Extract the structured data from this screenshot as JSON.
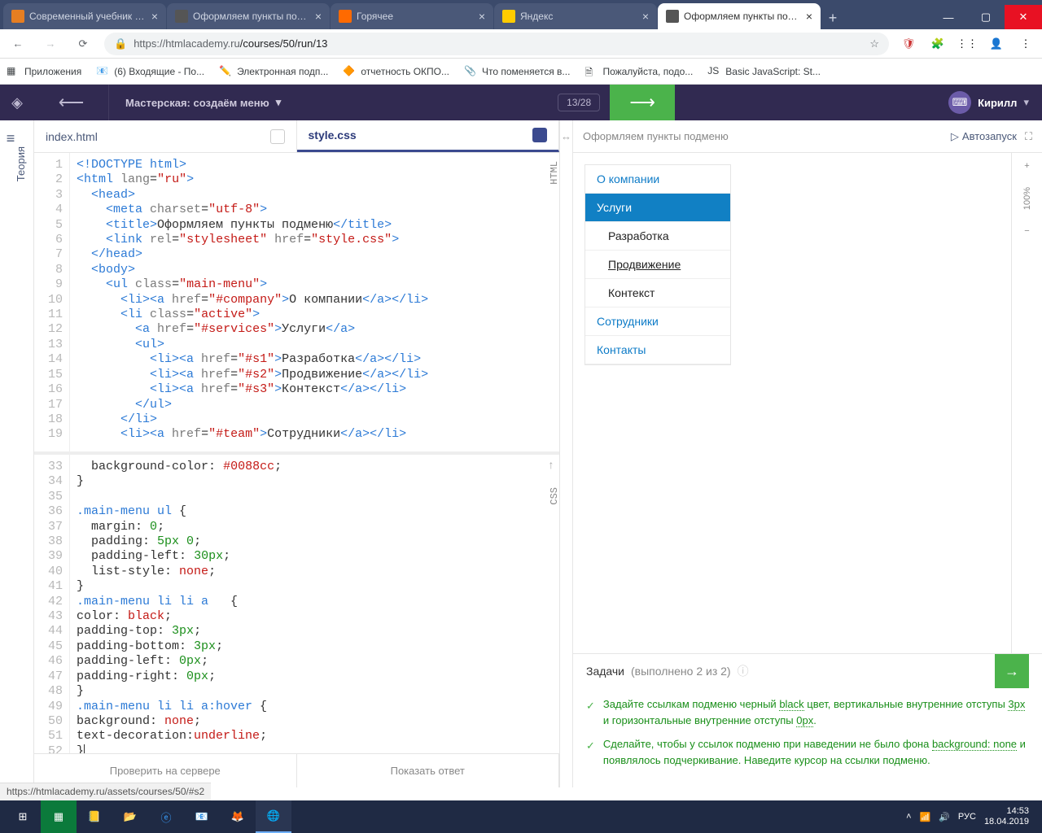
{
  "browser": {
    "tabs": [
      {
        "title": "Современный учебник Java",
        "favcolor": "#e67e22"
      },
      {
        "title": "Оформляем пункты подме",
        "favcolor": "#555"
      },
      {
        "title": "Горячее",
        "favcolor": "#ff6a00"
      },
      {
        "title": "Яндекс",
        "favcolor": "#ffcc00"
      },
      {
        "title": "Оформляем пункты подме",
        "favcolor": "#555",
        "active": true
      }
    ],
    "url_host": "https://htmlacademy.ru",
    "url_path": "/courses/50/run/13",
    "bookmarks": [
      {
        "label": "Приложения"
      },
      {
        "label": "(6) Входящие - По..."
      },
      {
        "label": "Электронная подп..."
      },
      {
        "label": "отчетность ОКПО..."
      },
      {
        "label": "Что поменяется в..."
      },
      {
        "label": "Пожалуйста, подо..."
      },
      {
        "label": "Basic JavaScript: St..."
      }
    ]
  },
  "app": {
    "title": "Мастерская: создаём меню",
    "progress": "13/28",
    "username": "Кирилл",
    "theory_label": "Теория"
  },
  "editor": {
    "tabs": [
      {
        "name": "index.html"
      },
      {
        "name": "style.css",
        "active": true
      }
    ],
    "html_vlabel": "HTML",
    "css_vlabel": "CSS",
    "footer": [
      "Проверить на сервере",
      "Показать ответ"
    ],
    "top_lines": [
      {
        "n": 1,
        "html": "<span class='t-tag'>&lt;!DOCTYPE html&gt;</span>"
      },
      {
        "n": 2,
        "html": "<span class='t-tag'>&lt;html</span> <span class='t-attr'>lang</span>=<span class='t-str'>\"ru\"</span><span class='t-tag'>&gt;</span>"
      },
      {
        "n": 3,
        "html": "  <span class='t-tag'>&lt;head&gt;</span>"
      },
      {
        "n": 4,
        "html": "    <span class='t-tag'>&lt;meta</span> <span class='t-attr'>charset</span>=<span class='t-str'>\"utf-8\"</span><span class='t-tag'>&gt;</span>"
      },
      {
        "n": 5,
        "html": "    <span class='t-tag'>&lt;title&gt;</span>Оформляем пункты подменю<span class='t-tag'>&lt;/title&gt;</span>"
      },
      {
        "n": 6,
        "html": "    <span class='t-tag'>&lt;link</span> <span class='t-attr'>rel</span>=<span class='t-str'>\"stylesheet\"</span> <span class='t-attr'>href</span>=<span class='t-str'>\"style.css\"</span><span class='t-tag'>&gt;</span>"
      },
      {
        "n": 7,
        "html": "  <span class='t-tag'>&lt;/head&gt;</span>"
      },
      {
        "n": 8,
        "html": "  <span class='t-tag'>&lt;body&gt;</span>"
      },
      {
        "n": 9,
        "html": "    <span class='t-tag'>&lt;ul</span> <span class='t-attr'>class</span>=<span class='t-str'>\"main-menu\"</span><span class='t-tag'>&gt;</span>"
      },
      {
        "n": 10,
        "html": "      <span class='t-tag'>&lt;li&gt;&lt;a</span> <span class='t-attr'>href</span>=<span class='t-str'>\"#company\"</span><span class='t-tag'>&gt;</span>О компании<span class='t-tag'>&lt;/a&gt;&lt;/li&gt;</span>"
      },
      {
        "n": 11,
        "html": "      <span class='t-tag'>&lt;li</span> <span class='t-attr'>class</span>=<span class='t-str'>\"active\"</span><span class='t-tag'>&gt;</span>"
      },
      {
        "n": 12,
        "html": "        <span class='t-tag'>&lt;a</span> <span class='t-attr'>href</span>=<span class='t-str'>\"#services\"</span><span class='t-tag'>&gt;</span>Услуги<span class='t-tag'>&lt;/a&gt;</span>"
      },
      {
        "n": 13,
        "html": "        <span class='t-tag'>&lt;ul&gt;</span>"
      },
      {
        "n": 14,
        "html": "          <span class='t-tag'>&lt;li&gt;&lt;a</span> <span class='t-attr'>href</span>=<span class='t-str'>\"#s1\"</span><span class='t-tag'>&gt;</span>Разработка<span class='t-tag'>&lt;/a&gt;&lt;/li&gt;</span>"
      },
      {
        "n": 15,
        "html": "          <span class='t-tag'>&lt;li&gt;&lt;a</span> <span class='t-attr'>href</span>=<span class='t-str'>\"#s2\"</span><span class='t-tag'>&gt;</span>Продвижение<span class='t-tag'>&lt;/a&gt;&lt;/li&gt;</span>"
      },
      {
        "n": 16,
        "html": "          <span class='t-tag'>&lt;li&gt;&lt;a</span> <span class='t-attr'>href</span>=<span class='t-str'>\"#s3\"</span><span class='t-tag'>&gt;</span>Контекст<span class='t-tag'>&lt;/a&gt;&lt;/li&gt;</span>"
      },
      {
        "n": 17,
        "html": "        <span class='t-tag'>&lt;/ul&gt;</span>"
      },
      {
        "n": 18,
        "html": "      <span class='t-tag'>&lt;/li&gt;</span>"
      },
      {
        "n": 19,
        "html": "      <span class='t-tag'>&lt;li&gt;&lt;a</span> <span class='t-attr'>href</span>=<span class='t-str'>\"#team\"</span><span class='t-tag'>&gt;</span>Сотрудники<span class='t-tag'>&lt;/a&gt;&lt;/li&gt;</span>"
      }
    ],
    "bottom_lines": [
      {
        "n": 33,
        "html": "  <span class='t-prop'>background-color</span>: <span class='t-val'>#0088cc</span>;"
      },
      {
        "n": 34,
        "html": "}"
      },
      {
        "n": 35,
        "html": ""
      },
      {
        "n": 36,
        "html": "<span class='t-sel'>.main-menu ul</span> {"
      },
      {
        "n": 37,
        "html": "  <span class='t-prop'>margin</span>: <span class='t-num'>0</span>;"
      },
      {
        "n": 38,
        "html": "  <span class='t-prop'>padding</span>: <span class='t-num'>5px 0</span>;"
      },
      {
        "n": 39,
        "html": "  <span class='t-prop'>padding-left</span>: <span class='t-num'>30px</span>;"
      },
      {
        "n": 40,
        "html": "  <span class='t-prop'>list-style</span>: <span class='t-val'>none</span>;"
      },
      {
        "n": 41,
        "html": "}"
      },
      {
        "n": 42,
        "html": "<span class='t-sel'>.main-menu li li a</span>   {"
      },
      {
        "n": 43,
        "html": "<span class='t-prop'>color</span>: <span class='t-val'>black</span>;"
      },
      {
        "n": 44,
        "html": "<span class='t-prop'>padding-top</span>: <span class='t-num'>3px</span>;"
      },
      {
        "n": 45,
        "html": "<span class='t-prop'>padding-bottom</span>: <span class='t-num'>3px</span>;"
      },
      {
        "n": 46,
        "html": "<span class='t-prop'>padding-left</span>: <span class='t-num'>0px</span>;"
      },
      {
        "n": 47,
        "html": "<span class='t-prop'>padding-right</span>: <span class='t-num'>0px</span>;"
      },
      {
        "n": 48,
        "html": "}"
      },
      {
        "n": 49,
        "html": "<span class='t-sel'>.main-menu li li a:hover</span> {"
      },
      {
        "n": 50,
        "html": "<span class='t-prop'>background</span>: <span class='t-val'>none</span>;"
      },
      {
        "n": 51,
        "html": "<span class='t-prop'>text-decoration</span>:<span class='t-val'>underline</span>;"
      },
      {
        "n": 52,
        "html": "}<span style='border-left:1px solid #333'>&nbsp;</span>"
      }
    ]
  },
  "preview": {
    "title": "Оформляем пункты подменю",
    "autorun": "Автозапуск",
    "menu": {
      "items": [
        {
          "label": "О компании"
        },
        {
          "label": "Услуги",
          "active": true,
          "sub": [
            {
              "label": "Разработка"
            },
            {
              "label": "Продвижение",
              "hover": true
            },
            {
              "label": "Контекст"
            }
          ]
        },
        {
          "label": "Сотрудники"
        },
        {
          "label": "Контакты"
        }
      ]
    },
    "zoom": "100%"
  },
  "tasks": {
    "heading": "Задачи",
    "progress": "(выполнено 2 из 2)",
    "items": [
      "Задайте ссылкам подменю черный <span class='kw'>black</span> цвет, вертикальные внутренние отступы <span class='kw'>3px</span> и горизонтальные внутренние отступы <span class='kw'>0px</span>.",
      "Сделайте, чтобы у ссылок подменю при наведении не было фона <span class='kw'>background: none</span> и появлялось подчеркивание. Наведите курсор на ссылки подменю."
    ]
  },
  "status_bar": "https://htmlacademy.ru/assets/courses/50/#s2",
  "taskbar": {
    "time": "14:53",
    "date": "18.04.2019",
    "lang": "РУС"
  }
}
